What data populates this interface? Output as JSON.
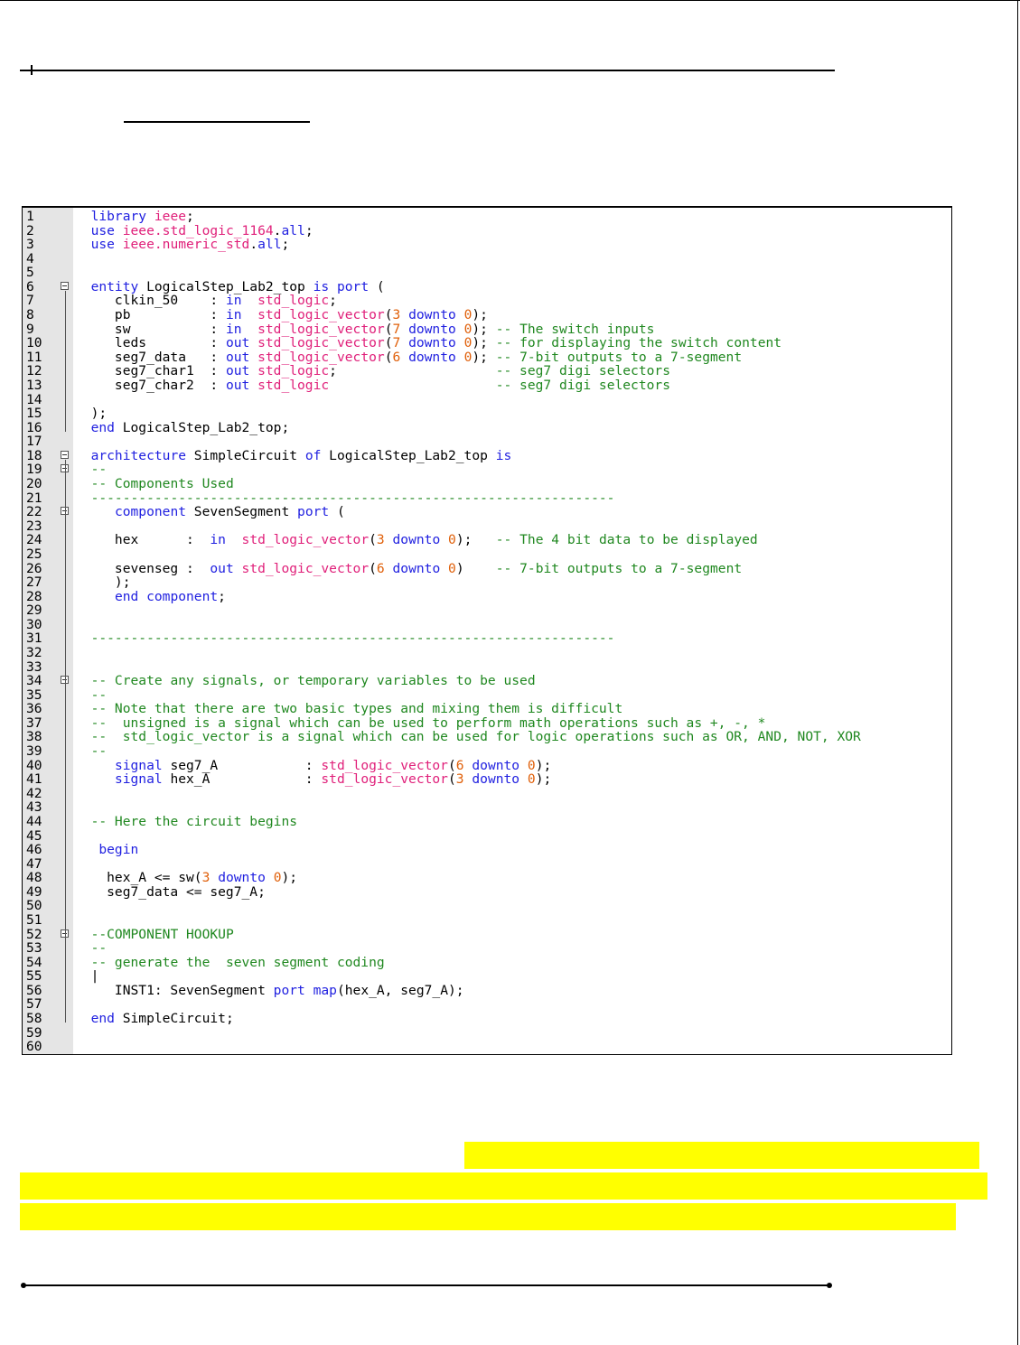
{
  "code": {
    "lines": [
      {
        "n": "1",
        "parts": [
          [
            "  ",
            ""
          ],
          [
            "library",
            "kw"
          ],
          [
            " ",
            ""
          ],
          [
            "ieee",
            "ty"
          ],
          [
            ";",
            ""
          ]
        ]
      },
      {
        "n": "2",
        "parts": [
          [
            "  ",
            ""
          ],
          [
            "use",
            "kw"
          ],
          [
            " ",
            ""
          ],
          [
            "ieee.std_logic_1164",
            "ty"
          ],
          [
            ".",
            ""
          ],
          [
            "all",
            "kw"
          ],
          [
            ";",
            ""
          ]
        ]
      },
      {
        "n": "3",
        "parts": [
          [
            "  ",
            ""
          ],
          [
            "use",
            "kw"
          ],
          [
            " ",
            ""
          ],
          [
            "ieee.numeric_std",
            "ty"
          ],
          [
            ".",
            ""
          ],
          [
            "all",
            "kw"
          ],
          [
            ";",
            ""
          ]
        ]
      },
      {
        "n": "4",
        "parts": []
      },
      {
        "n": "5",
        "parts": []
      },
      {
        "n": "6",
        "fold": true,
        "parts": [
          [
            "  ",
            ""
          ],
          [
            "entity",
            "kw"
          ],
          [
            " LogicalStep_Lab2_top ",
            ""
          ],
          [
            "is",
            "kw"
          ],
          [
            " ",
            ""
          ],
          [
            "port",
            "kw"
          ],
          [
            " (",
            ""
          ]
        ]
      },
      {
        "n": "7",
        "parts": [
          [
            "     clkin_50    : ",
            ""
          ],
          [
            "in",
            "kw"
          ],
          [
            "  ",
            ""
          ],
          [
            "std_logic",
            "ty"
          ],
          [
            ";",
            ""
          ]
        ]
      },
      {
        "n": "8",
        "parts": [
          [
            "     pb          : ",
            ""
          ],
          [
            "in",
            "kw"
          ],
          [
            "  ",
            ""
          ],
          [
            "std_logic_vector",
            "ty"
          ],
          [
            "(",
            ""
          ],
          [
            "3",
            "nm"
          ],
          [
            " ",
            ""
          ],
          [
            "downto",
            "kw"
          ],
          [
            " ",
            ""
          ],
          [
            "0",
            "nm"
          ],
          [
            ");",
            ""
          ]
        ]
      },
      {
        "n": "9",
        "parts": [
          [
            "     sw          : ",
            ""
          ],
          [
            "in",
            "kw"
          ],
          [
            "  ",
            ""
          ],
          [
            "std_logic_vector",
            "ty"
          ],
          [
            "(",
            ""
          ],
          [
            "7",
            "nm"
          ],
          [
            " ",
            ""
          ],
          [
            "downto",
            "kw"
          ],
          [
            " ",
            ""
          ],
          [
            "0",
            "nm"
          ],
          [
            "); ",
            ""
          ],
          [
            "-- The switch inputs",
            "cm"
          ]
        ]
      },
      {
        "n": "10",
        "parts": [
          [
            "     leds        : ",
            ""
          ],
          [
            "out",
            "kw"
          ],
          [
            " ",
            ""
          ],
          [
            "std_logic_vector",
            "ty"
          ],
          [
            "(",
            ""
          ],
          [
            "7",
            "nm"
          ],
          [
            " ",
            ""
          ],
          [
            "downto",
            "kw"
          ],
          [
            " ",
            ""
          ],
          [
            "0",
            "nm"
          ],
          [
            "); ",
            ""
          ],
          [
            "-- for displaying the switch content",
            "cm"
          ]
        ]
      },
      {
        "n": "11",
        "parts": [
          [
            "     seg7_data   : ",
            ""
          ],
          [
            "out",
            "kw"
          ],
          [
            " ",
            ""
          ],
          [
            "std_logic_vector",
            "ty"
          ],
          [
            "(",
            ""
          ],
          [
            "6",
            "nm"
          ],
          [
            " ",
            ""
          ],
          [
            "downto",
            "kw"
          ],
          [
            " ",
            ""
          ],
          [
            "0",
            "nm"
          ],
          [
            "); ",
            ""
          ],
          [
            "-- 7-bit outputs to a 7-segment",
            "cm"
          ]
        ]
      },
      {
        "n": "12",
        "parts": [
          [
            "     seg7_char1  : ",
            ""
          ],
          [
            "out",
            "kw"
          ],
          [
            " ",
            ""
          ],
          [
            "std_logic",
            "ty"
          ],
          [
            ";                    ",
            ""
          ],
          [
            "-- seg7 digi selectors",
            "cm"
          ]
        ]
      },
      {
        "n": "13",
        "parts": [
          [
            "     seg7_char2  : ",
            ""
          ],
          [
            "out",
            "kw"
          ],
          [
            " ",
            ""
          ],
          [
            "std_logic",
            "ty"
          ],
          [
            "                     ",
            ""
          ],
          [
            "-- seg7 digi selectors",
            "cm"
          ]
        ]
      },
      {
        "n": "14",
        "parts": []
      },
      {
        "n": "15",
        "parts": [
          [
            "  );",
            ""
          ]
        ]
      },
      {
        "n": "16",
        "parts": [
          [
            "  ",
            ""
          ],
          [
            "end",
            "kw"
          ],
          [
            " LogicalStep_Lab2_top;",
            ""
          ]
        ]
      },
      {
        "n": "17",
        "parts": []
      },
      {
        "n": "18",
        "fold": true,
        "parts": [
          [
            "  ",
            ""
          ],
          [
            "architecture",
            "kw"
          ],
          [
            " SimpleCircuit ",
            ""
          ],
          [
            "of",
            "kw"
          ],
          [
            " LogicalStep_Lab2_top ",
            ""
          ],
          [
            "is",
            "kw"
          ]
        ]
      },
      {
        "n": "19",
        "fold": true,
        "parts": [
          [
            "  ",
            ""
          ],
          [
            "--",
            "cm"
          ]
        ]
      },
      {
        "n": "20",
        "parts": [
          [
            "  ",
            ""
          ],
          [
            "-- Components Used",
            "cm"
          ]
        ]
      },
      {
        "n": "21",
        "parts": [
          [
            "  ",
            ""
          ],
          [
            "------------------------------------------------------------------",
            "cm"
          ]
        ]
      },
      {
        "n": "22",
        "fold": true,
        "parts": [
          [
            "     ",
            ""
          ],
          [
            "component",
            "kw"
          ],
          [
            " SevenSegment ",
            ""
          ],
          [
            "port",
            "kw"
          ],
          [
            " (",
            ""
          ]
        ]
      },
      {
        "n": "23",
        "parts": []
      },
      {
        "n": "24",
        "parts": [
          [
            "     hex      :  ",
            ""
          ],
          [
            "in",
            "kw"
          ],
          [
            "  ",
            ""
          ],
          [
            "std_logic_vector",
            "ty"
          ],
          [
            "(",
            ""
          ],
          [
            "3",
            "nm"
          ],
          [
            " ",
            ""
          ],
          [
            "downto",
            "kw"
          ],
          [
            " ",
            ""
          ],
          [
            "0",
            "nm"
          ],
          [
            ");   ",
            ""
          ],
          [
            "-- The 4 bit data to be displayed",
            "cm"
          ]
        ]
      },
      {
        "n": "25",
        "parts": []
      },
      {
        "n": "26",
        "parts": [
          [
            "     sevenseg :  ",
            ""
          ],
          [
            "out",
            "kw"
          ],
          [
            " ",
            ""
          ],
          [
            "std_logic_vector",
            "ty"
          ],
          [
            "(",
            ""
          ],
          [
            "6",
            "nm"
          ],
          [
            " ",
            ""
          ],
          [
            "downto",
            "kw"
          ],
          [
            " ",
            ""
          ],
          [
            "0",
            "nm"
          ],
          [
            ")    ",
            ""
          ],
          [
            "-- 7-bit outputs to a 7-segment",
            "cm"
          ]
        ]
      },
      {
        "n": "27",
        "parts": [
          [
            "     );",
            ""
          ]
        ]
      },
      {
        "n": "28",
        "parts": [
          [
            "     ",
            ""
          ],
          [
            "end",
            "kw"
          ],
          [
            " ",
            ""
          ],
          [
            "component",
            "kw"
          ],
          [
            ";",
            ""
          ]
        ]
      },
      {
        "n": "29",
        "parts": []
      },
      {
        "n": "30",
        "parts": []
      },
      {
        "n": "31",
        "parts": [
          [
            "  ",
            ""
          ],
          [
            "------------------------------------------------------------------",
            "cm"
          ]
        ]
      },
      {
        "n": "32",
        "parts": []
      },
      {
        "n": "33",
        "parts": []
      },
      {
        "n": "34",
        "fold": true,
        "parts": [
          [
            "  ",
            ""
          ],
          [
            "-- Create any signals, or temporary variables to be used",
            "cm"
          ]
        ]
      },
      {
        "n": "35",
        "parts": [
          [
            "  ",
            ""
          ],
          [
            "--",
            "cm"
          ]
        ]
      },
      {
        "n": "36",
        "parts": [
          [
            "  ",
            ""
          ],
          [
            "-- Note that there are two basic types and mixing them is difficult",
            "cm"
          ]
        ]
      },
      {
        "n": "37",
        "parts": [
          [
            "  ",
            ""
          ],
          [
            "--  unsigned is a signal which can be used to perform math operations such as +, -, *",
            "cm"
          ]
        ]
      },
      {
        "n": "38",
        "parts": [
          [
            "  ",
            ""
          ],
          [
            "--  std_logic_vector is a signal which can be used for logic operations such as OR, AND, NOT, XOR",
            "cm"
          ]
        ]
      },
      {
        "n": "39",
        "parts": [
          [
            "  ",
            ""
          ],
          [
            "--",
            "cm"
          ]
        ]
      },
      {
        "n": "40",
        "parts": [
          [
            "     ",
            ""
          ],
          [
            "signal",
            "kw"
          ],
          [
            " seg7_A           : ",
            ""
          ],
          [
            "std_logic_vector",
            "ty"
          ],
          [
            "(",
            ""
          ],
          [
            "6",
            "nm"
          ],
          [
            " ",
            ""
          ],
          [
            "downto",
            "kw"
          ],
          [
            " ",
            ""
          ],
          [
            "0",
            "nm"
          ],
          [
            ");",
            ""
          ]
        ]
      },
      {
        "n": "41",
        "parts": [
          [
            "     ",
            ""
          ],
          [
            "signal",
            "kw"
          ],
          [
            " hex_A            : ",
            ""
          ],
          [
            "std_logic_vector",
            "ty"
          ],
          [
            "(",
            ""
          ],
          [
            "3",
            "nm"
          ],
          [
            " ",
            ""
          ],
          [
            "downto",
            "kw"
          ],
          [
            " ",
            ""
          ],
          [
            "0",
            "nm"
          ],
          [
            ");",
            ""
          ]
        ]
      },
      {
        "n": "42",
        "parts": []
      },
      {
        "n": "43",
        "parts": []
      },
      {
        "n": "44",
        "parts": [
          [
            "  ",
            ""
          ],
          [
            "-- Here the circuit begins",
            "cm"
          ]
        ]
      },
      {
        "n": "45",
        "parts": []
      },
      {
        "n": "46",
        "parts": [
          [
            "   ",
            ""
          ],
          [
            "begin",
            "kw"
          ]
        ]
      },
      {
        "n": "47",
        "parts": []
      },
      {
        "n": "48",
        "parts": [
          [
            "    hex_A <= sw(",
            ""
          ],
          [
            "3",
            "nm"
          ],
          [
            " ",
            ""
          ],
          [
            "downto",
            "kw"
          ],
          [
            " ",
            ""
          ],
          [
            "0",
            "nm"
          ],
          [
            ");",
            ""
          ]
        ]
      },
      {
        "n": "49",
        "parts": [
          [
            "    seg7_data <= seg7_A;",
            ""
          ]
        ]
      },
      {
        "n": "50",
        "parts": []
      },
      {
        "n": "51",
        "parts": []
      },
      {
        "n": "52",
        "fold": true,
        "parts": [
          [
            "  ",
            ""
          ],
          [
            "--COMPONENT HOOKUP",
            "cm"
          ]
        ]
      },
      {
        "n": "53",
        "parts": [
          [
            "  ",
            ""
          ],
          [
            "--",
            "cm"
          ]
        ]
      },
      {
        "n": "54",
        "parts": [
          [
            "  ",
            ""
          ],
          [
            "-- generate the  seven segment coding",
            "cm"
          ]
        ]
      },
      {
        "n": "55",
        "parts": [
          [
            "  |",
            ""
          ]
        ]
      },
      {
        "n": "56",
        "parts": [
          [
            "     INST1: SevenSegment ",
            ""
          ],
          [
            "port",
            "kw"
          ],
          [
            " ",
            ""
          ],
          [
            "map",
            "kw"
          ],
          [
            "(hex_A, seg7_A);",
            ""
          ]
        ]
      },
      {
        "n": "57",
        "parts": []
      },
      {
        "n": "58",
        "parts": [
          [
            "  ",
            ""
          ],
          [
            "end",
            "kw"
          ],
          [
            " SimpleCircuit;",
            ""
          ]
        ]
      },
      {
        "n": "59",
        "parts": []
      },
      {
        "n": "60",
        "parts": []
      }
    ]
  },
  "colors": {
    "keyword": "#1f1fe0",
    "type": "#e0207a",
    "number": "#e0600a",
    "comment": "#208820",
    "highlight": "#ffff00"
  }
}
